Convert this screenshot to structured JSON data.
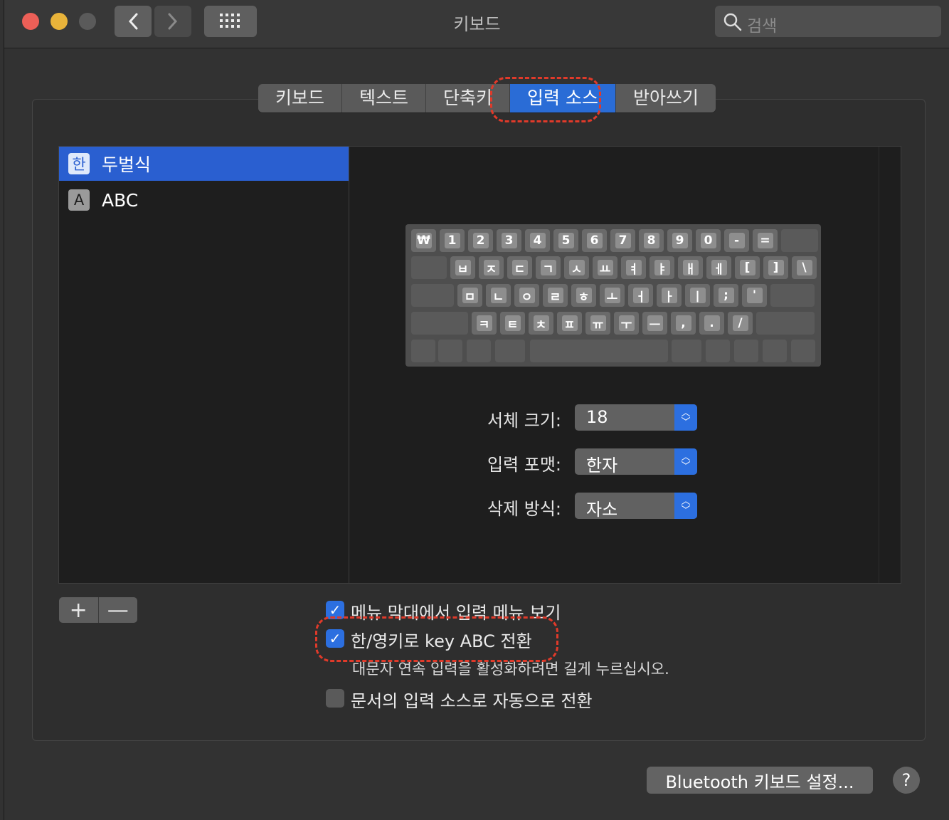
{
  "window": {
    "title": "키보드"
  },
  "search": {
    "placeholder": "검색"
  },
  "tabs": [
    {
      "label": "키보드"
    },
    {
      "label": "텍스트"
    },
    {
      "label": "단축키"
    },
    {
      "label": "입력 소스",
      "selected": true
    },
    {
      "label": "받아쓰기"
    }
  ],
  "input_sources": [
    {
      "badge": "한",
      "label": "두벌식",
      "selected": true
    },
    {
      "badge": "A",
      "label": "ABC",
      "selected": false
    }
  ],
  "keyboard": {
    "row1": [
      "₩",
      "1",
      "2",
      "3",
      "4",
      "5",
      "6",
      "7",
      "8",
      "9",
      "0",
      "-",
      "="
    ],
    "row2": [
      "ㅂ",
      "ㅈ",
      "ㄷ",
      "ㄱ",
      "ㅅ",
      "ㅛ",
      "ㅕ",
      "ㅑ",
      "ㅐ",
      "ㅔ",
      "[",
      "]",
      "\\"
    ],
    "row3": [
      "ㅁ",
      "ㄴ",
      "ㅇ",
      "ㄹ",
      "ㅎ",
      "ㅗ",
      "ㅓ",
      "ㅏ",
      "ㅣ",
      ";",
      "'"
    ],
    "row4": [
      "ㅋ",
      "ㅌ",
      "ㅊ",
      "ㅍ",
      "ㅠ",
      "ㅜ",
      "ㅡ",
      ",",
      ".",
      "/"
    ]
  },
  "options": {
    "font_size": {
      "label": "서체 크기:",
      "value": "18"
    },
    "input_format": {
      "label": "입력 포맷:",
      "value": "한자"
    },
    "delete_mode": {
      "label": "삭제 방식:",
      "value": "자소"
    }
  },
  "list_buttons": {
    "add": "+",
    "remove": "—"
  },
  "checkboxes": {
    "show_menu": {
      "label": "메뉴 막대에서 입력 메뉴 보기",
      "checked": true
    },
    "han_eng_key": {
      "label": "한/영키로 key ABC 전환",
      "checked": true,
      "hint": "대문자 연속 입력을 활성화하려면 길게 누르십시오."
    },
    "auto_switch": {
      "label": "문서의 입력 소스로 자동으로 전환",
      "checked": false
    }
  },
  "footer": {
    "bluetooth_button": "Bluetooth 키보드 설정...",
    "help": "?"
  },
  "colors": {
    "accent": "#2c6fe0",
    "annotation": "#e03a2a",
    "close": "#ec5f57",
    "minimize": "#e8b33a",
    "zoom_disabled": "#5a5a5a"
  }
}
